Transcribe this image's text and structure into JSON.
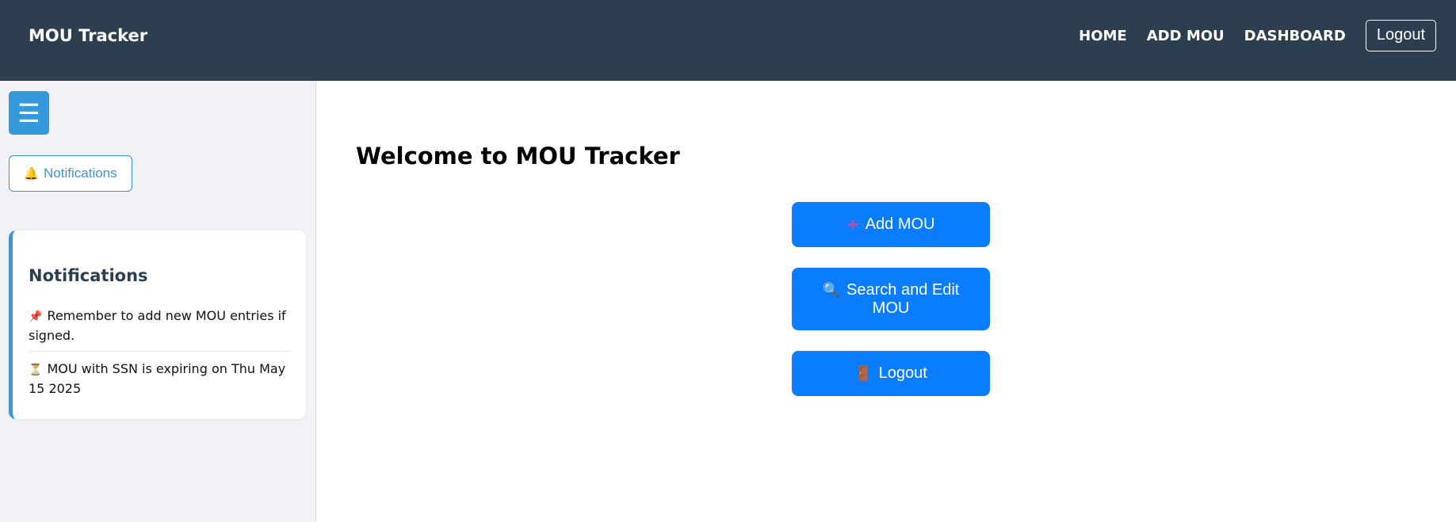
{
  "navbar": {
    "brand": "MOU Tracker",
    "links": [
      "HOME",
      "ADD MOU",
      "DASHBOARD"
    ],
    "logout_label": "Logout"
  },
  "sidebar": {
    "menu_icon": "☰",
    "notifications_button": {
      "icon": "🔔",
      "label": "Notifications"
    },
    "panel": {
      "title": "Notifications",
      "items": [
        {
          "icon": "📌",
          "text": "Remember to add new MOU entries if signed."
        },
        {
          "icon": "⏳",
          "text": "MOU with SSN is expiring on Thu May 15 2025"
        }
      ]
    }
  },
  "main": {
    "title": "Welcome to MOU Tracker",
    "buttons": [
      {
        "icon": "➕",
        "label": "Add MOU"
      },
      {
        "icon": "🔍",
        "label": "Search and Edit MOU"
      },
      {
        "icon": "🚪",
        "label": "Logout"
      }
    ]
  },
  "colors": {
    "navbar_bg": "#2c3e50",
    "accent": "#3498db",
    "primary_button": "#0a7cff",
    "sidebar_bg": "#f0f2f5"
  }
}
